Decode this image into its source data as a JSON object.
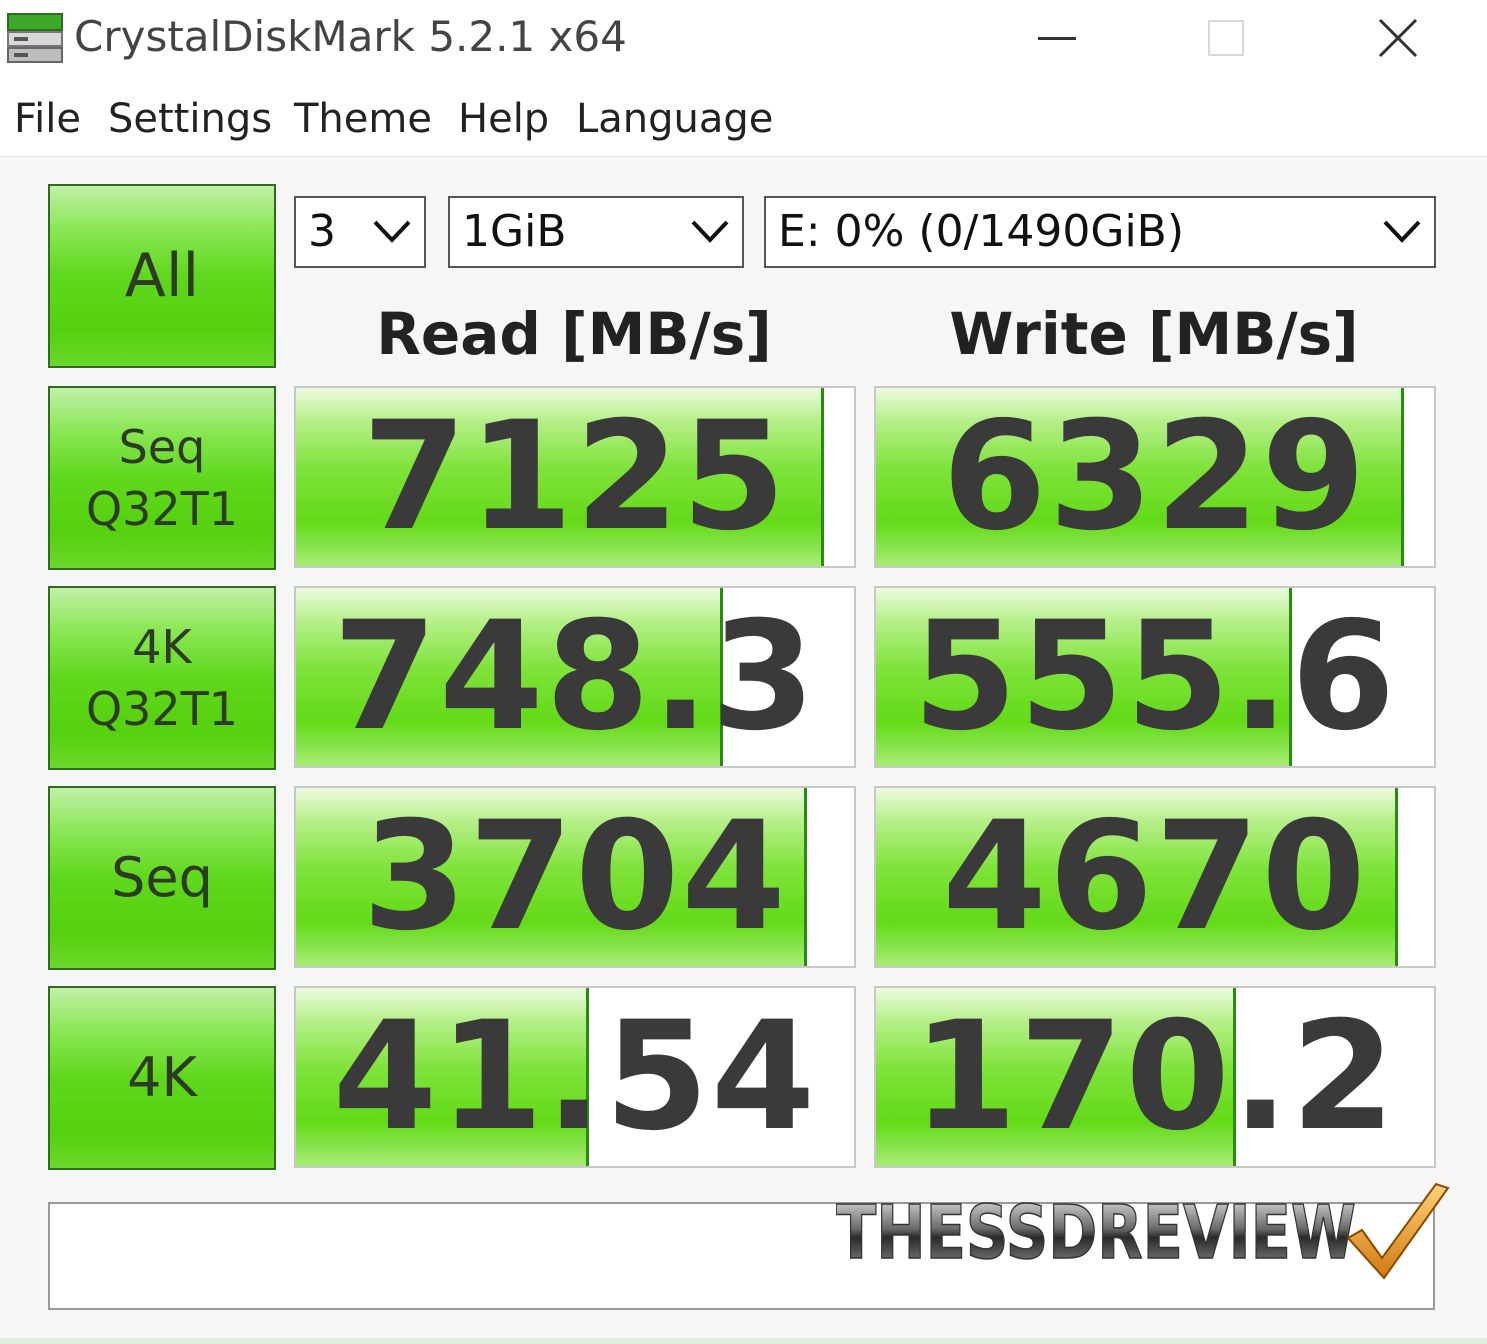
{
  "window": {
    "title": "CrystalDiskMark 5.2.1 x64"
  },
  "menu": [
    "File",
    "Settings",
    "Theme",
    "Help",
    "Language"
  ],
  "controls": {
    "all_button": "All",
    "count": "3",
    "size": "1GiB",
    "drive": "E: 0% (0/1490GiB)"
  },
  "headers": {
    "read": "Read [MB/s]",
    "write": "Write [MB/s]"
  },
  "rows": [
    {
      "label": [
        "Seq",
        "Q32T1"
      ],
      "read": "7125",
      "write": "6329",
      "read_fill": 0.94,
      "write_fill": 0.94
    },
    {
      "label": [
        "4K",
        "Q32T1"
      ],
      "read": "748.3",
      "write": "555.6",
      "read_fill": 0.76,
      "write_fill": 0.74
    },
    {
      "label": [
        "Seq"
      ],
      "read": "3704",
      "write": "4670",
      "read_fill": 0.91,
      "write_fill": 0.93
    },
    {
      "label": [
        "4K"
      ],
      "read": "41.54",
      "write": "170.2",
      "read_fill": 0.52,
      "write_fill": 0.64
    }
  ],
  "comment": "",
  "watermark": {
    "text": "THESSDREVIEW"
  },
  "colors": {
    "accent_green": "#55d10e",
    "bar_border": "#2a8a12",
    "text_dark": "#3a3a3a",
    "logo_orange": "#e8961a"
  },
  "icons": {
    "app": "disk-icon",
    "minimize": "minimize-icon",
    "maximize": "maximize-icon",
    "close": "close-icon",
    "dropdown": "chevron-down-icon"
  }
}
